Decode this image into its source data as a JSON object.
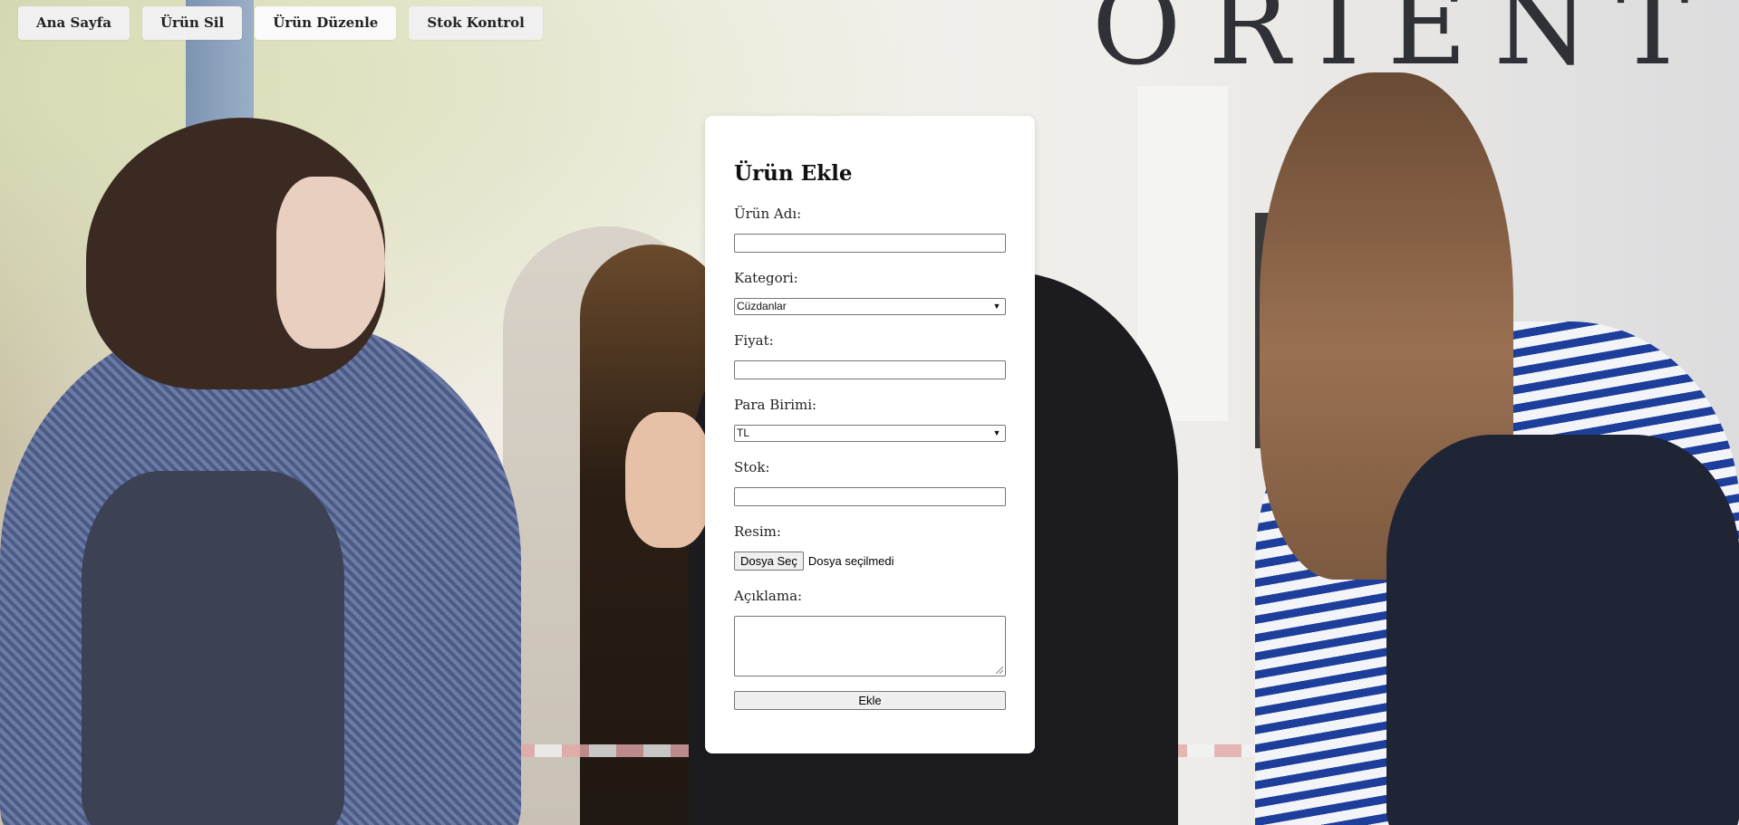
{
  "nav": {
    "items": [
      {
        "label": "Ana Sayfa"
      },
      {
        "label": "Ürün Sil"
      },
      {
        "label": "Ürün Düzenle"
      },
      {
        "label": "Stok Kontrol"
      }
    ]
  },
  "background": {
    "brand_text": "ORIENT"
  },
  "form": {
    "title": "Ürün Ekle",
    "product_name": {
      "label": "Ürün Adı:",
      "value": ""
    },
    "category": {
      "label": "Kategori:",
      "value": "Cüzdanlar"
    },
    "price": {
      "label": "Fiyat:",
      "value": ""
    },
    "currency": {
      "label": "Para Birimi:",
      "value": "TL"
    },
    "stock": {
      "label": "Stok:",
      "value": ""
    },
    "image": {
      "label": "Resim:",
      "button_label": "Dosya Seç",
      "status": "Dosya seçilmedi"
    },
    "description": {
      "label": "Açıklama:",
      "value": ""
    },
    "submit_label": "Ekle"
  },
  "icons": {
    "select_chevron": "chevron-down-icon"
  }
}
